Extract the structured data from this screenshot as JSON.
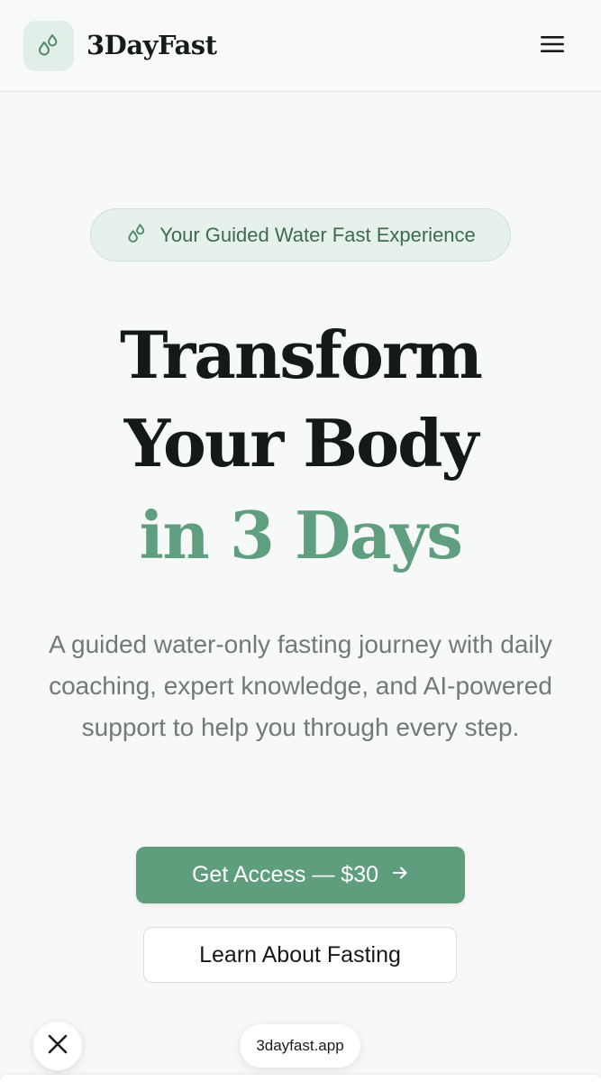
{
  "header": {
    "app_name": "3DayFast",
    "logo_icon": "water-drops-icon",
    "menu_icon": "hamburger-menu-icon"
  },
  "hero": {
    "badge_icon": "water-drops-icon",
    "badge_text": "Your Guided Water Fast Experience",
    "title": "Transform Your Body",
    "title_accent": "in 3 Days",
    "subtitle": "A guided water-only fasting journey with daily coaching, expert knowledge, and AI-powered support to help you through every step."
  },
  "actions": {
    "primary_label": "Get Access — $30",
    "primary_icon": "arrow-right-icon",
    "secondary_label": "Learn About Fasting"
  },
  "browser": {
    "close_icon": "close-icon",
    "url": "3dayfast.app"
  },
  "colors": {
    "accent": "#5e9e7d",
    "badge_bg": "#e6f1eb",
    "background": "#f7f9f8",
    "heading": "#141a17",
    "muted_text": "#737977"
  }
}
